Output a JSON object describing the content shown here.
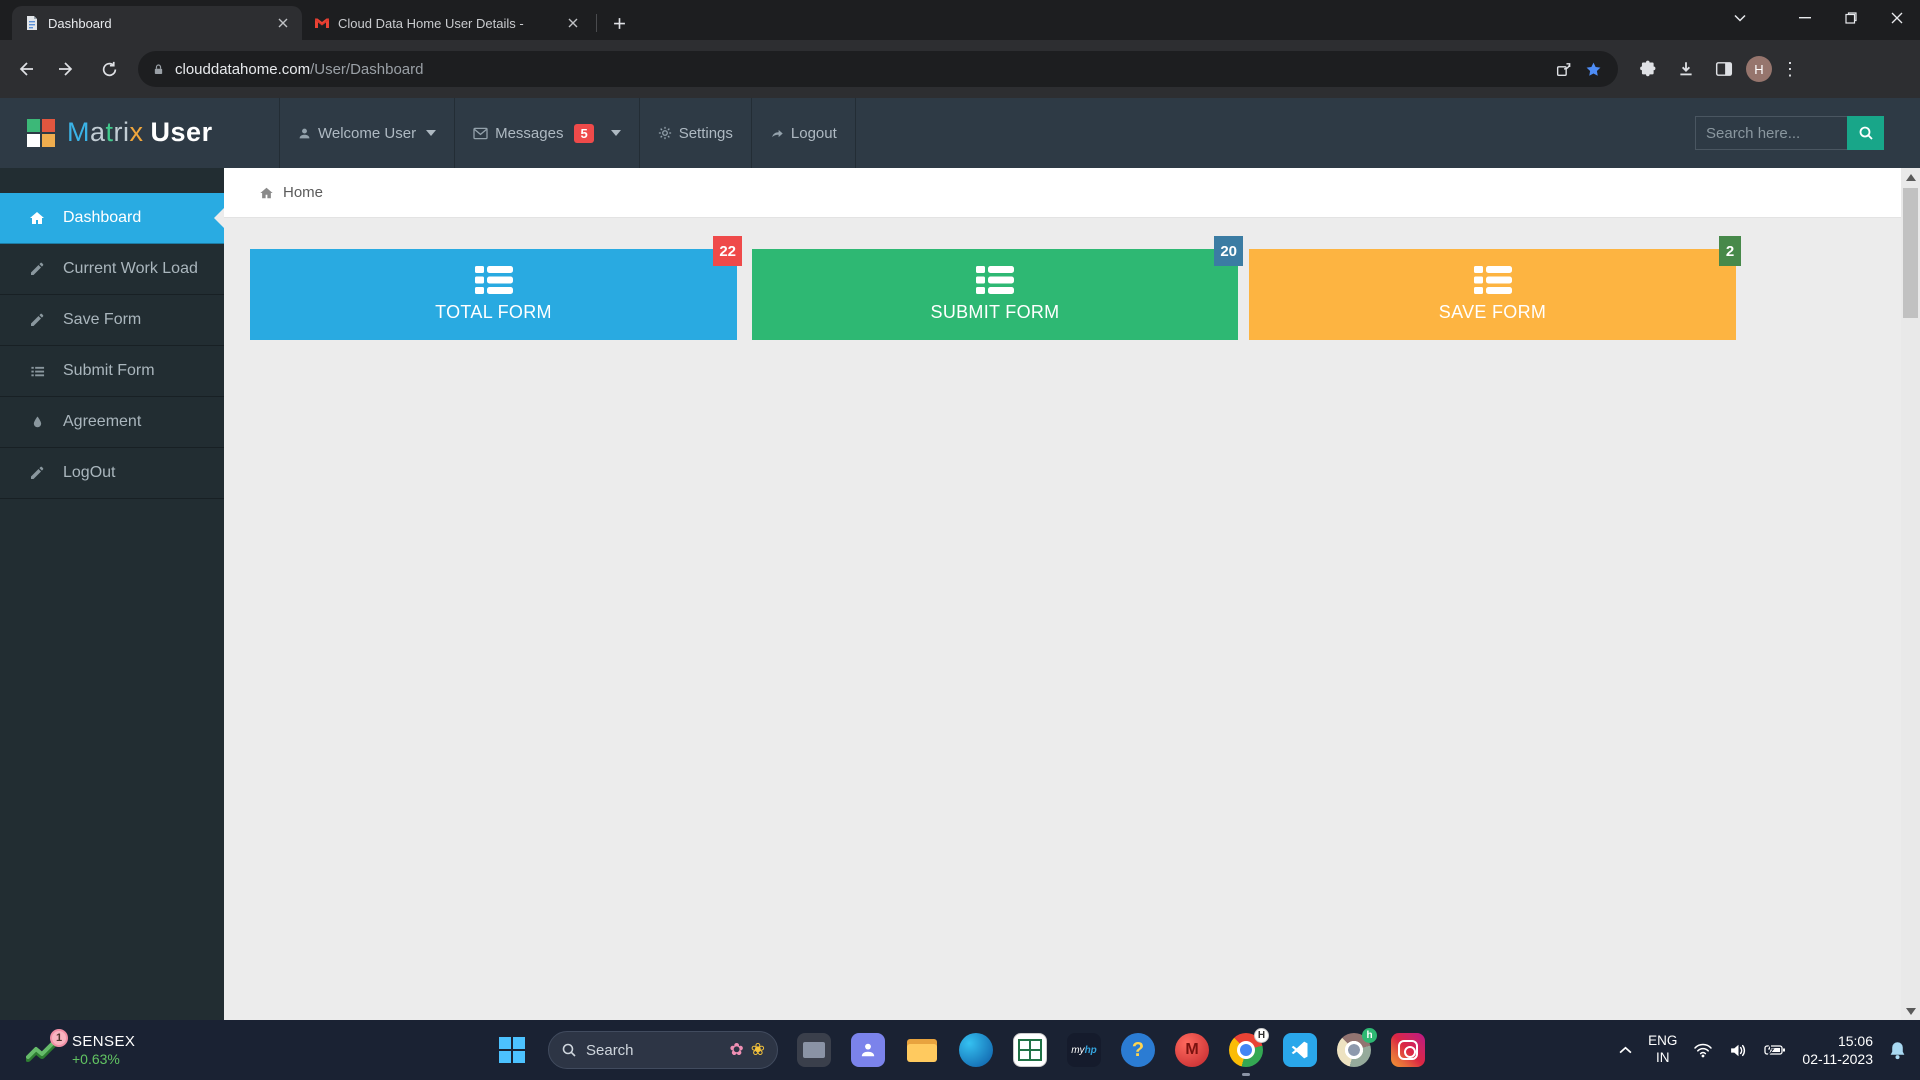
{
  "browser": {
    "tab1": {
      "title": "Dashboard"
    },
    "tab2": {
      "title": "Cloud Data Home User Details -"
    },
    "url": {
      "host": "clouddatahome.com",
      "path": "/User/Dashboard"
    },
    "profile_initial": "H"
  },
  "app": {
    "logo": {
      "letters": [
        "M",
        "a",
        "t",
        "r",
        "i",
        "x"
      ],
      "part2": "User"
    },
    "nav": {
      "welcome": "Welcome User",
      "messages": "Messages",
      "messages_count": "5",
      "settings": "Settings",
      "logout": "Logout"
    },
    "search": {
      "placeholder": "Search here..."
    }
  },
  "sidebar": {
    "items": [
      {
        "label": "Dashboard",
        "active": true
      },
      {
        "label": "Current Work Load",
        "active": false
      },
      {
        "label": "Save Form",
        "active": false
      },
      {
        "label": "Submit Form",
        "active": false
      },
      {
        "label": "Agreement",
        "active": false
      },
      {
        "label": "LogOut",
        "active": false
      }
    ]
  },
  "breadcrumb": {
    "label": "Home"
  },
  "cards": [
    {
      "label": "TOTAL FORM",
      "count": "22",
      "color": "#29aae1",
      "badge_color": "#ef4a4a"
    },
    {
      "label": "SUBMIT FORM",
      "count": "20",
      "color": "#2eb873",
      "badge_color": "#3b7ca3"
    },
    {
      "label": "SAVE FORM",
      "count": "2",
      "color": "#fdb441",
      "badge_color": "#47894a"
    }
  ],
  "taskbar": {
    "stock": {
      "symbol": "SENSEX",
      "change": "+0.63%",
      "badge": "1"
    },
    "search_label": "Search",
    "app_labels": {
      "myhp_my": "my",
      "myhp_hp": "hp"
    },
    "help_glyph": "?",
    "mcafee_glyph": "M",
    "chrome_badge": "H",
    "profile_badge": "h",
    "tray": {
      "language": "ENG",
      "region": "IN",
      "time": "15:06",
      "date": "02-11-2023"
    }
  },
  "colors": {
    "accent_blue": "#29abe2",
    "header_bg": "#2e3a45",
    "sidebar_bg": "#222d32",
    "taskbar_bg": "#1a2233",
    "search_button_green": "#18a689",
    "stock_change_green": "#62c462"
  }
}
